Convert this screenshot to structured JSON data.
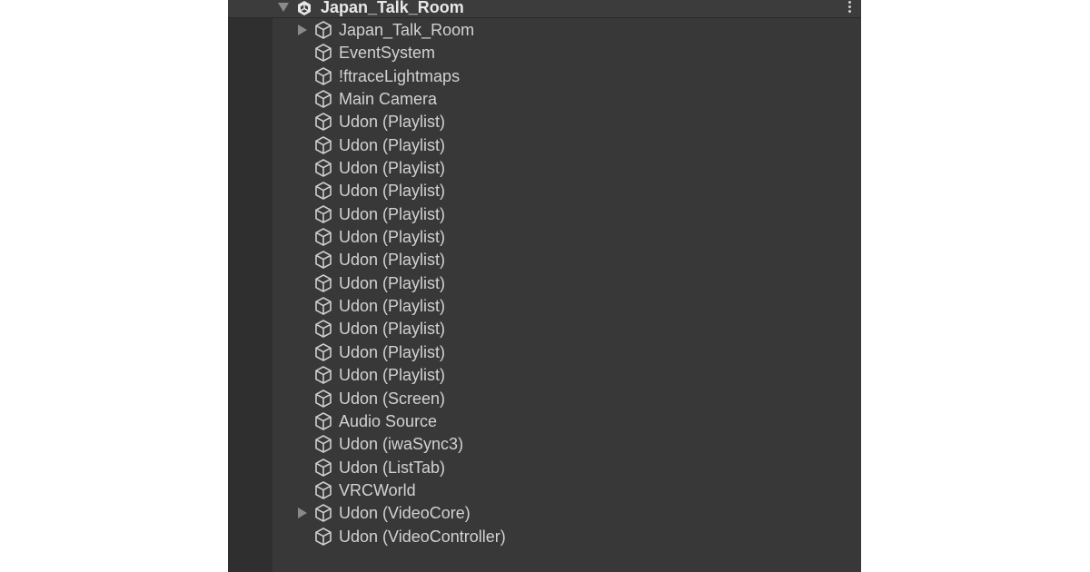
{
  "hierarchy": {
    "scene_name": "Japan_Talk_Room",
    "items": [
      {
        "label": "Japan_Talk_Room",
        "has_children": true
      },
      {
        "label": "EventSystem",
        "has_children": false
      },
      {
        "label": "!ftraceLightmaps",
        "has_children": false
      },
      {
        "label": "Main Camera",
        "has_children": false
      },
      {
        "label": "Udon (Playlist)",
        "has_children": false
      },
      {
        "label": "Udon (Playlist)",
        "has_children": false
      },
      {
        "label": "Udon (Playlist)",
        "has_children": false
      },
      {
        "label": "Udon (Playlist)",
        "has_children": false
      },
      {
        "label": "Udon (Playlist)",
        "has_children": false
      },
      {
        "label": "Udon (Playlist)",
        "has_children": false
      },
      {
        "label": "Udon (Playlist)",
        "has_children": false
      },
      {
        "label": "Udon (Playlist)",
        "has_children": false
      },
      {
        "label": "Udon (Playlist)",
        "has_children": false
      },
      {
        "label": "Udon (Playlist)",
        "has_children": false
      },
      {
        "label": "Udon (Playlist)",
        "has_children": false
      },
      {
        "label": "Udon (Playlist)",
        "has_children": false
      },
      {
        "label": "Udon (Screen)",
        "has_children": false
      },
      {
        "label": "Audio Source",
        "has_children": false
      },
      {
        "label": "Udon (iwaSync3)",
        "has_children": false
      },
      {
        "label": "Udon (ListTab)",
        "has_children": false
      },
      {
        "label": "VRCWorld",
        "has_children": false
      },
      {
        "label": "Udon (VideoCore)",
        "has_children": true
      },
      {
        "label": "Udon (VideoController)",
        "has_children": false
      }
    ]
  },
  "icons": {
    "scene": "unity-scene-icon",
    "object": "gameobject-cube-icon",
    "menu": "more-vertical-icon"
  },
  "colors": {
    "panel_bg": "#383838",
    "gutter_bg": "#2f2f2f",
    "text": "#d2d2d2",
    "header_text": "#e8e8e8"
  }
}
